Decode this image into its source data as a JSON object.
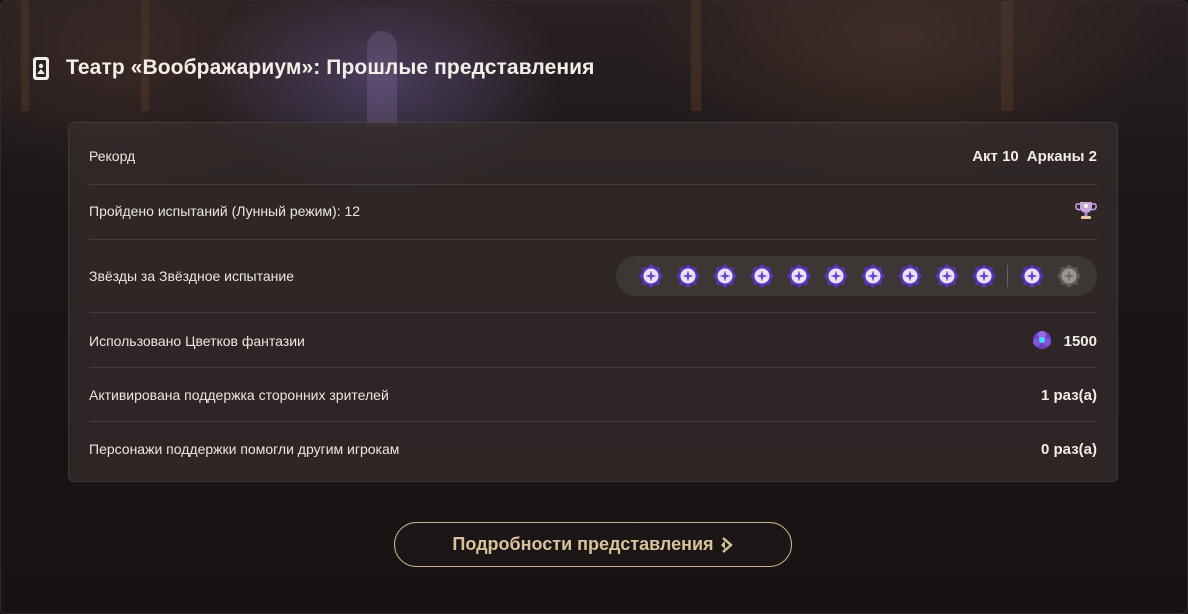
{
  "header": {
    "title": "Театр «Воображариум»: Прошлые представления",
    "icon": "theater-card-icon"
  },
  "stats": {
    "record": {
      "label": "Рекорд",
      "act": "Акт 10",
      "arcana": "Арканы 2"
    },
    "challenges": {
      "label": "Пройдено испытаний (Лунный режим): 12",
      "icon": "trophy-icon"
    },
    "stars": {
      "label": "Звёзды за Звёздное испытание",
      "earned": 11,
      "total": 12
    },
    "flowers": {
      "label": "Использовано Цветков фантазии",
      "value": "1500",
      "icon": "fantasy-flower-icon"
    },
    "support": {
      "label": "Активирована поддержка сторонних зрителей",
      "value": "1 раз(а)"
    },
    "helped": {
      "label": "Персонажи поддержки помогли другим игрокам",
      "value": "0 раз(а)"
    }
  },
  "button": {
    "label": "Подробности представления"
  },
  "colors": {
    "accent": "#d8c29b",
    "star_active": "#7a4fd6",
    "star_inactive": "#6a6563"
  }
}
